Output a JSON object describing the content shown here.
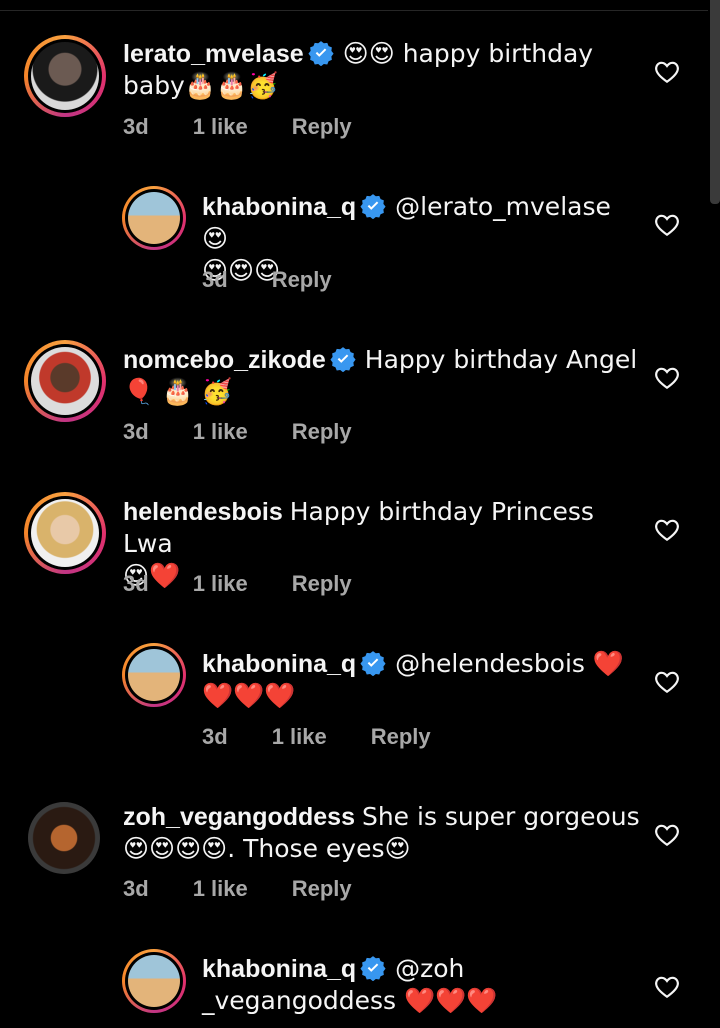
{
  "comments": [
    {
      "username": "lerato_mvelase",
      "text_a": "😍😍 happy birthday",
      "text_b": "baby🎂🎂🥳",
      "time": "3d",
      "likes": "1 like",
      "reply": "Reply"
    },
    {
      "username": "khabonina_q",
      "text_a": "@lerato_mvelase 😍",
      "text_b": "😍😍😍",
      "time": "3d",
      "reply": "Reply"
    },
    {
      "username": "nomcebo_zikode",
      "text_a": "Happy birthday  Angel",
      "text_b": "🎈 🎂 🥳",
      "time": "3d",
      "likes": "1 like",
      "reply": "Reply"
    },
    {
      "username": "helendesbois",
      "text_a": "Happy birthday Princess Lwa",
      "text_b": "😍❤️",
      "time": "3d",
      "likes": "1 like",
      "reply": "Reply"
    },
    {
      "username": "khabonina_q",
      "text_a": "@helendesbois ❤️",
      "text_b": "❤️❤️❤️",
      "time": "3d",
      "likes": "1 like",
      "reply": "Reply"
    },
    {
      "username": "zoh_vegangoddess",
      "text_a": "She is super gorgeous",
      "text_b": "😍😍😍😍. Those eyes😍",
      "time": "3d",
      "likes": "1 like",
      "reply": "Reply"
    },
    {
      "username": "khabonina_q",
      "text_a": "@zoh",
      "text_b": "_vegangoddess ❤️❤️❤️",
      "time": "",
      "reply": ""
    }
  ],
  "colors": {
    "background": "#000000",
    "text": "#f5f5f5",
    "meta": "#a8a8a8",
    "verified": "#3897f0"
  }
}
